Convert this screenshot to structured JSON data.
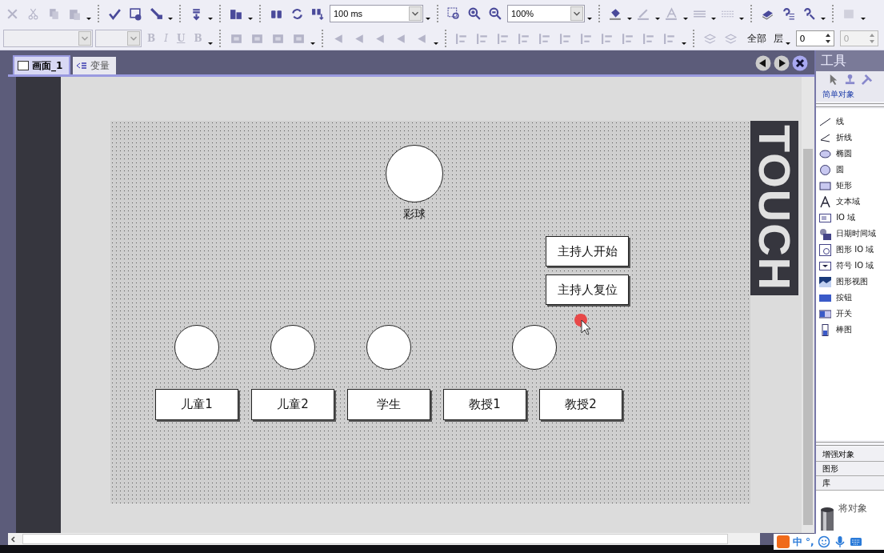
{
  "toolbar": {
    "interval": "100 ms",
    "zoom": "100%",
    "format_buttons": [
      "B",
      "I",
      "U",
      "B"
    ],
    "layer_all": "全部",
    "layer_label": "层",
    "layer_value": "0",
    "layer_value_disabled": "0"
  },
  "tabs": [
    {
      "label": "画面_1",
      "selected": true
    },
    {
      "label": "变量",
      "selected": false
    }
  ],
  "screen": {
    "side_label": "TOUCH",
    "objects": [
      {
        "kind": "lamp",
        "caption": "彩球"
      },
      {
        "kind": "button",
        "label": "主持人开始"
      },
      {
        "kind": "button",
        "label": "主持人复位"
      },
      {
        "kind": "lamp"
      },
      {
        "kind": "lamp"
      },
      {
        "kind": "lamp"
      },
      {
        "kind": "lamp"
      },
      {
        "kind": "button",
        "label": "儿童1"
      },
      {
        "kind": "button",
        "label": "儿童2"
      },
      {
        "kind": "button",
        "label": "学生"
      },
      {
        "kind": "button",
        "label": "教授1"
      },
      {
        "kind": "button",
        "label": "教授2"
      }
    ]
  },
  "tools_panel": {
    "title": "工具",
    "section": "简单对象",
    "items": [
      {
        "kind": "line",
        "label": "线"
      },
      {
        "kind": "polyline",
        "label": "折线"
      },
      {
        "kind": "ellipse",
        "label": "椭圆"
      },
      {
        "kind": "circle",
        "label": "圆"
      },
      {
        "kind": "rect",
        "label": "矩形"
      },
      {
        "kind": "text",
        "label": "文本域"
      },
      {
        "kind": "io",
        "label": "IO 域"
      },
      {
        "kind": "datetime",
        "label": "日期时间域"
      },
      {
        "kind": "graphic-io",
        "label": "图形 IO 域"
      },
      {
        "kind": "symbol-io",
        "label": "符号 IO 域"
      },
      {
        "kind": "graphic-view",
        "label": "图形视图"
      },
      {
        "kind": "button",
        "label": "按钮"
      },
      {
        "kind": "switch",
        "label": "开关"
      },
      {
        "kind": "bar",
        "label": "棒图"
      }
    ],
    "other_sections": [
      "增强对象",
      "图形",
      "库"
    ],
    "library_hint": "将对象"
  },
  "ime_bar": {
    "mode": "中",
    "punctuation": "°,"
  }
}
